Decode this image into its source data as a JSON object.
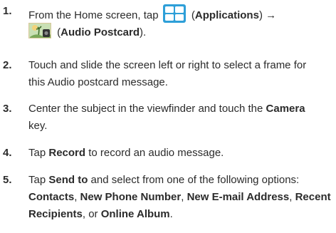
{
  "steps": [
    {
      "number": "1.",
      "line1": {
        "text_before": "From the Home screen, tap",
        "icon": "applications-grid-icon",
        "open_paren": "(",
        "bold": "Applications",
        "close_paren": ")",
        "arrow": "→"
      },
      "line2": {
        "icon": "audio-postcard-icon",
        "open_paren": "(",
        "bold": "Audio Postcard",
        "close_paren": ")."
      }
    },
    {
      "number": "2.",
      "line1": "Touch and slide the screen left or right to select a frame for",
      "line2": "this Audio postcard message."
    },
    {
      "number": "3.",
      "line1_text": "Center the subject in the viewfinder and touch the",
      "line1_bold": "Camera",
      "line2": "key."
    },
    {
      "number": "4.",
      "text_before": "Tap",
      "bold": "Record",
      "text_after": "to record an audio message."
    },
    {
      "number": "5.",
      "line1_before": "Tap",
      "line1_bold": "Send to",
      "line1_after": "and select from one of the following options:",
      "line2_parts": [
        {
          "bold": "Contacts",
          "sep": ", "
        },
        {
          "bold": "New Phone Number",
          "sep": ", "
        },
        {
          "bold": "New E-mail Address",
          "sep": ", "
        },
        {
          "bold": "Recent",
          "sep": ""
        }
      ],
      "line3_parts": [
        {
          "bold": "Recipients",
          "sep": ", or "
        },
        {
          "bold": "Online Album",
          "sep": "."
        }
      ]
    }
  ],
  "colors": {
    "text": "#2b2b2b",
    "app_icon_bg": "#2e9fd8",
    "app_icon_tile": "#ffffff"
  }
}
